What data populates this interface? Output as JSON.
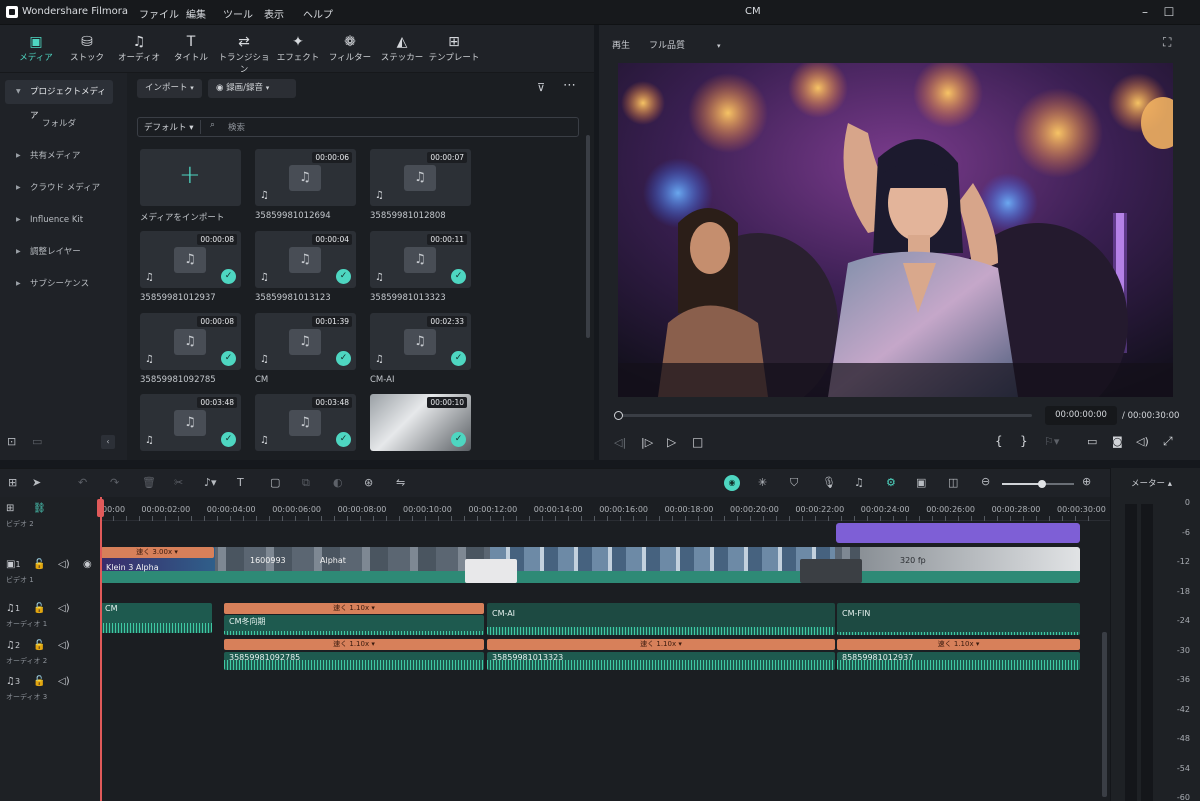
{
  "titlebar": {
    "app_name": "Wondershare Filmora",
    "menus": [
      "ファイル",
      "編集",
      "ツール",
      "表示",
      "ヘルプ"
    ],
    "project": "CM"
  },
  "toptabs": [
    {
      "label": "メディア",
      "icon": "media-icon"
    },
    {
      "label": "ストック",
      "icon": "stock-icon"
    },
    {
      "label": "オーディオ",
      "icon": "audio-icon"
    },
    {
      "label": "タイトル",
      "icon": "title-icon"
    },
    {
      "label": "トランジション",
      "icon": "transition-icon"
    },
    {
      "label": "エフェクト",
      "icon": "effect-icon"
    },
    {
      "label": "フィルター",
      "icon": "filter-icon"
    },
    {
      "label": "ステッカー",
      "icon": "sticker-icon"
    },
    {
      "label": "テンプレート",
      "icon": "template-icon"
    }
  ],
  "sidebar": {
    "items": [
      "プロジェクトメディア",
      "フォルダ",
      "共有メディア",
      "クラウド メディア",
      "Influence Kit",
      "調整レイヤー",
      "サブシーケンス"
    ]
  },
  "media": {
    "import_label": "インポート",
    "record_label": "録画/録音",
    "sort_label": "デフォルト",
    "search_placeholder": "検索",
    "import_tile_label": "メディアをインポート",
    "items": [
      {
        "name": "35859981012694",
        "duration": "00:00:06",
        "checked": false
      },
      {
        "name": "35859981012808",
        "duration": "00:00:07",
        "checked": false
      },
      {
        "name": "35859981012937",
        "duration": "00:00:08",
        "checked": true
      },
      {
        "name": "35859981013123",
        "duration": "00:00:04",
        "checked": true
      },
      {
        "name": "35859981013323",
        "duration": "00:00:11",
        "checked": true
      },
      {
        "name": "35859981092785",
        "duration": "00:00:08",
        "checked": true
      },
      {
        "name": "CM",
        "duration": "00:01:39",
        "checked": true
      },
      {
        "name": "CM-AI",
        "duration": "00:02:33",
        "checked": true
      },
      {
        "name": "",
        "duration": "00:03:48",
        "checked": true
      },
      {
        "name": "",
        "duration": "00:03:48",
        "checked": true
      },
      {
        "name": "",
        "duration": "00:00:10",
        "checked": true
      }
    ]
  },
  "preview": {
    "mode_label": "再生",
    "quality": "フル品質",
    "current_time": "00:00:00:00",
    "total_time": "/ 00:00:30:00"
  },
  "timeline": {
    "ruler": [
      "00:00",
      "00:00:02:00",
      "00:00:04:00",
      "00:00:06:00",
      "00:00:08:00",
      "00:00:10:00",
      "00:00:12:00",
      "00:00:14:00",
      "00:00:16:00",
      "00:00:18:00",
      "00:00:20:00",
      "00:00:22:00",
      "00:00:24:00",
      "00:00:26:00",
      "00:00:28:00",
      "00:00:30:00"
    ],
    "tracks": [
      {
        "num": "",
        "label": "ビデオ 2"
      },
      {
        "num": "1",
        "label": "ビデオ 1"
      },
      {
        "num": "1",
        "label": "オーディオ 1"
      },
      {
        "num": "2",
        "label": "オーディオ 2"
      },
      {
        "num": "3",
        "label": "オーディオ 3"
      }
    ],
    "video_speed": "速く 3.00x",
    "video_clips": [
      "Klein 3 Alpha",
      "Alpha.mp4",
      "1600993",
      "Alphat",
      "ーーmp4",
      "320 fp"
    ],
    "audio1": {
      "speed": "速く 1.10x",
      "clips": [
        "CM",
        "CM冬向期",
        "CM-AI",
        "CM-FIN"
      ]
    },
    "audio2": {
      "speed": "速く 1.10x",
      "clips": [
        "35859981092785",
        "35859981013323",
        "85859981012937"
      ]
    }
  },
  "meter": {
    "title": "メーター",
    "scale": [
      "0",
      "-6",
      "-12",
      "-18",
      "-24",
      "-30",
      "-36",
      "-42",
      "-48",
      "-54",
      "-60"
    ]
  },
  "colors": {
    "accent": "#4ed6c1",
    "speed": "#d7805a",
    "audio": "#1e5a4f",
    "purple": "#7e5fd6"
  }
}
